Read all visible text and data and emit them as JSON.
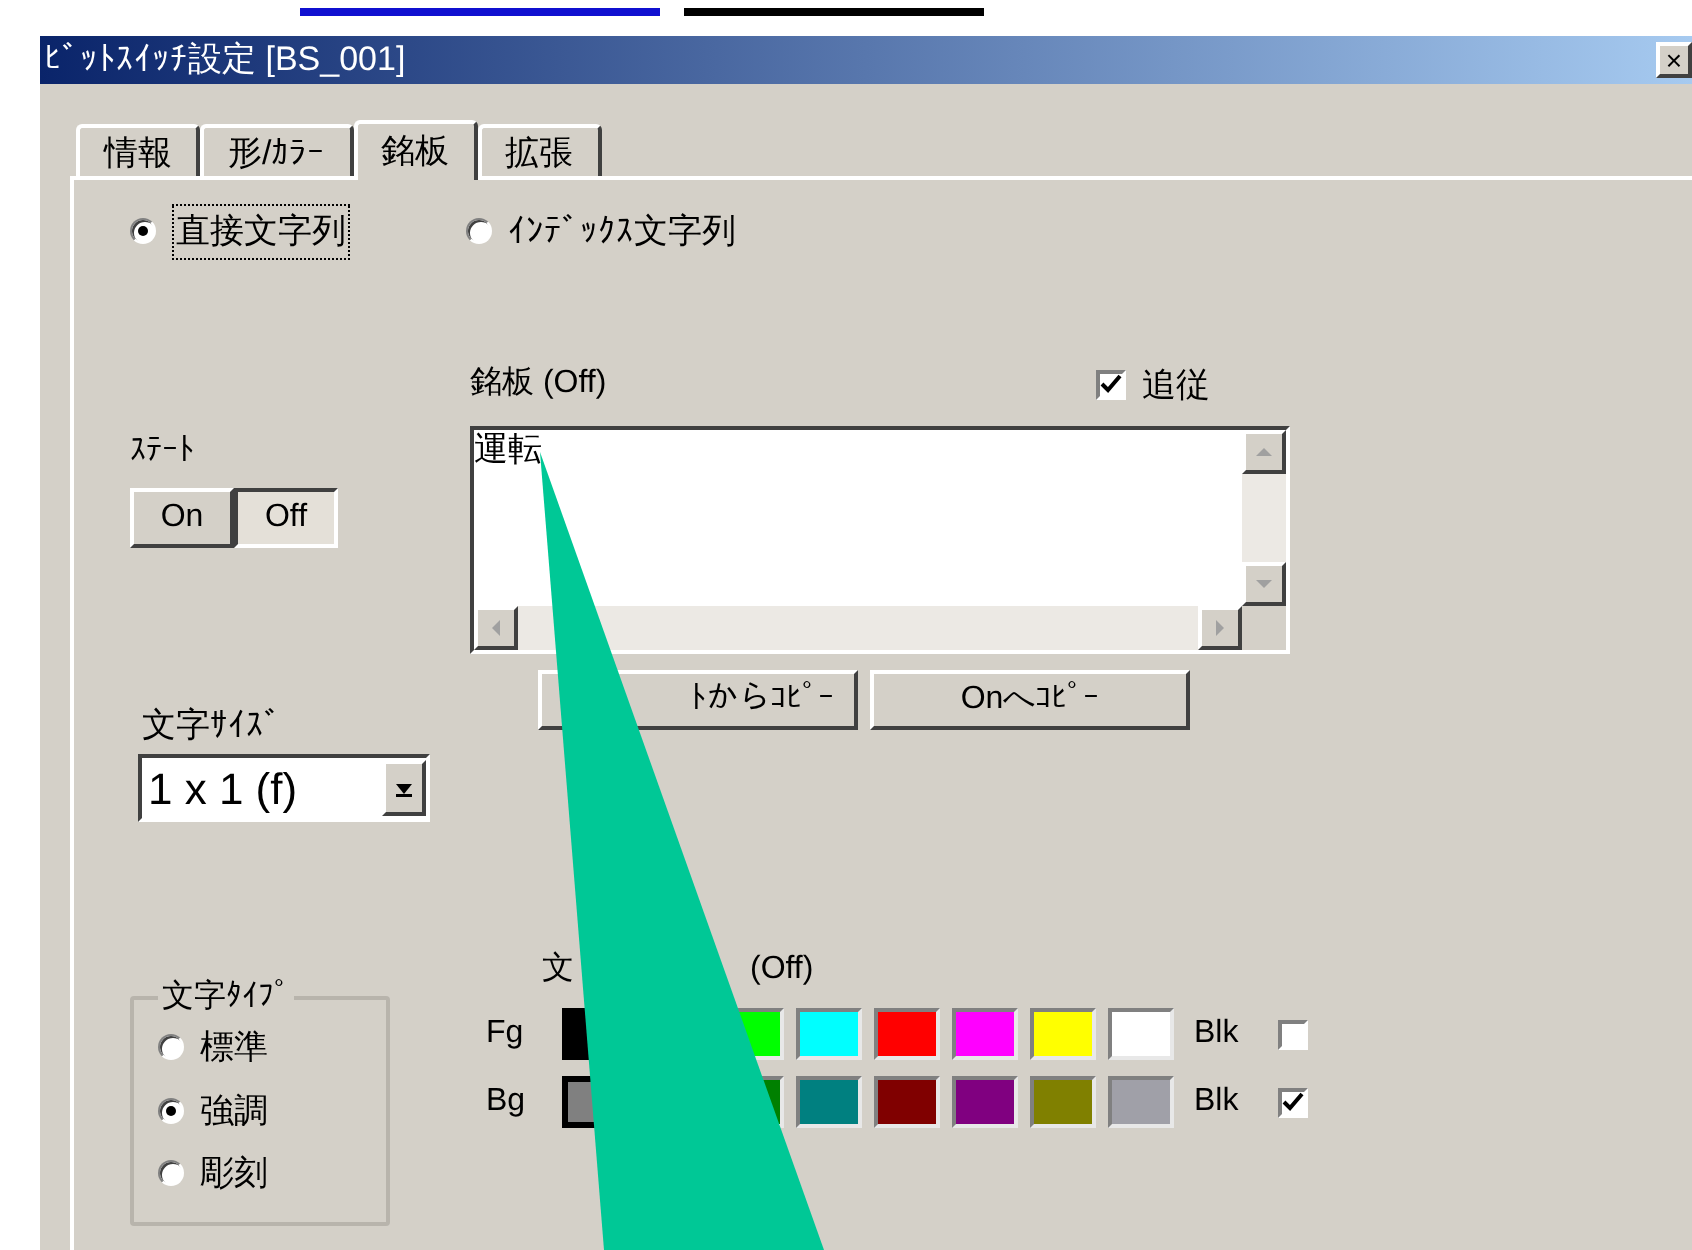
{
  "window": {
    "title": "ﾋﾞｯﾄｽｲｯﾁ設定 [BS_001]",
    "close": "×"
  },
  "tabs": [
    {
      "label": "情報",
      "selected": false
    },
    {
      "label": "形/ｶﾗｰ",
      "selected": false
    },
    {
      "label": "銘板",
      "selected": true
    },
    {
      "label": "拡張",
      "selected": false
    }
  ],
  "source": [
    {
      "label": "直接文字列",
      "selected": true
    },
    {
      "label": "ｲﾝﾃﾞｯｸｽ文字列",
      "selected": false
    }
  ],
  "nameplate": {
    "label": "銘板 (Off)",
    "follow": {
      "label": "追従",
      "checked": true
    },
    "text": "運転"
  },
  "state": {
    "label": "ｽﾃｰﾄ",
    "buttons": [
      {
        "label": "On",
        "selected": false
      },
      {
        "label": "Off",
        "selected": true
      }
    ]
  },
  "copy_buttons": [
    "ﾄからｺﾋﾟｰ",
    "Onへｺﾋﾟｰ"
  ],
  "text_size": {
    "label": "文字ｻｲｽﾞ",
    "value": "1 x 1 (f)"
  },
  "text_type": {
    "label": "文字ﾀｲﾌﾟ",
    "options": [
      {
        "label": "標準",
        "selected": false
      },
      {
        "label": "強調",
        "selected": true
      },
      {
        "label": "彫刻",
        "selected": false
      }
    ]
  },
  "text_color": {
    "label_start": "文",
    "label_end": "(Off)",
    "rows": [
      {
        "label": "Fg",
        "blink_label": "Blk",
        "blink": false,
        "swatches": [
          {
            "color": "#000000",
            "selected": true
          },
          {
            "color": "#00ff00",
            "selected": false
          },
          {
            "color": "#00ffff",
            "selected": false
          },
          {
            "color": "#ff0000",
            "selected": false
          },
          {
            "color": "#ff00ff",
            "selected": false
          },
          {
            "color": "#ffff00",
            "selected": false
          },
          {
            "color": "#ffffff",
            "selected": false
          }
        ]
      },
      {
        "label": "Bg",
        "blink_label": "Blk",
        "blink": true,
        "swatches": [
          {
            "color": "#808080",
            "selected": true
          },
          {
            "color": "#008000",
            "selected": false
          },
          {
            "color": "#008080",
            "selected": false
          },
          {
            "color": "#800000",
            "selected": false
          },
          {
            "color": "#800080",
            "selected": false
          },
          {
            "color": "#808000",
            "selected": false
          },
          {
            "color": "#a0a0a8",
            "selected": false
          }
        ]
      }
    ]
  }
}
